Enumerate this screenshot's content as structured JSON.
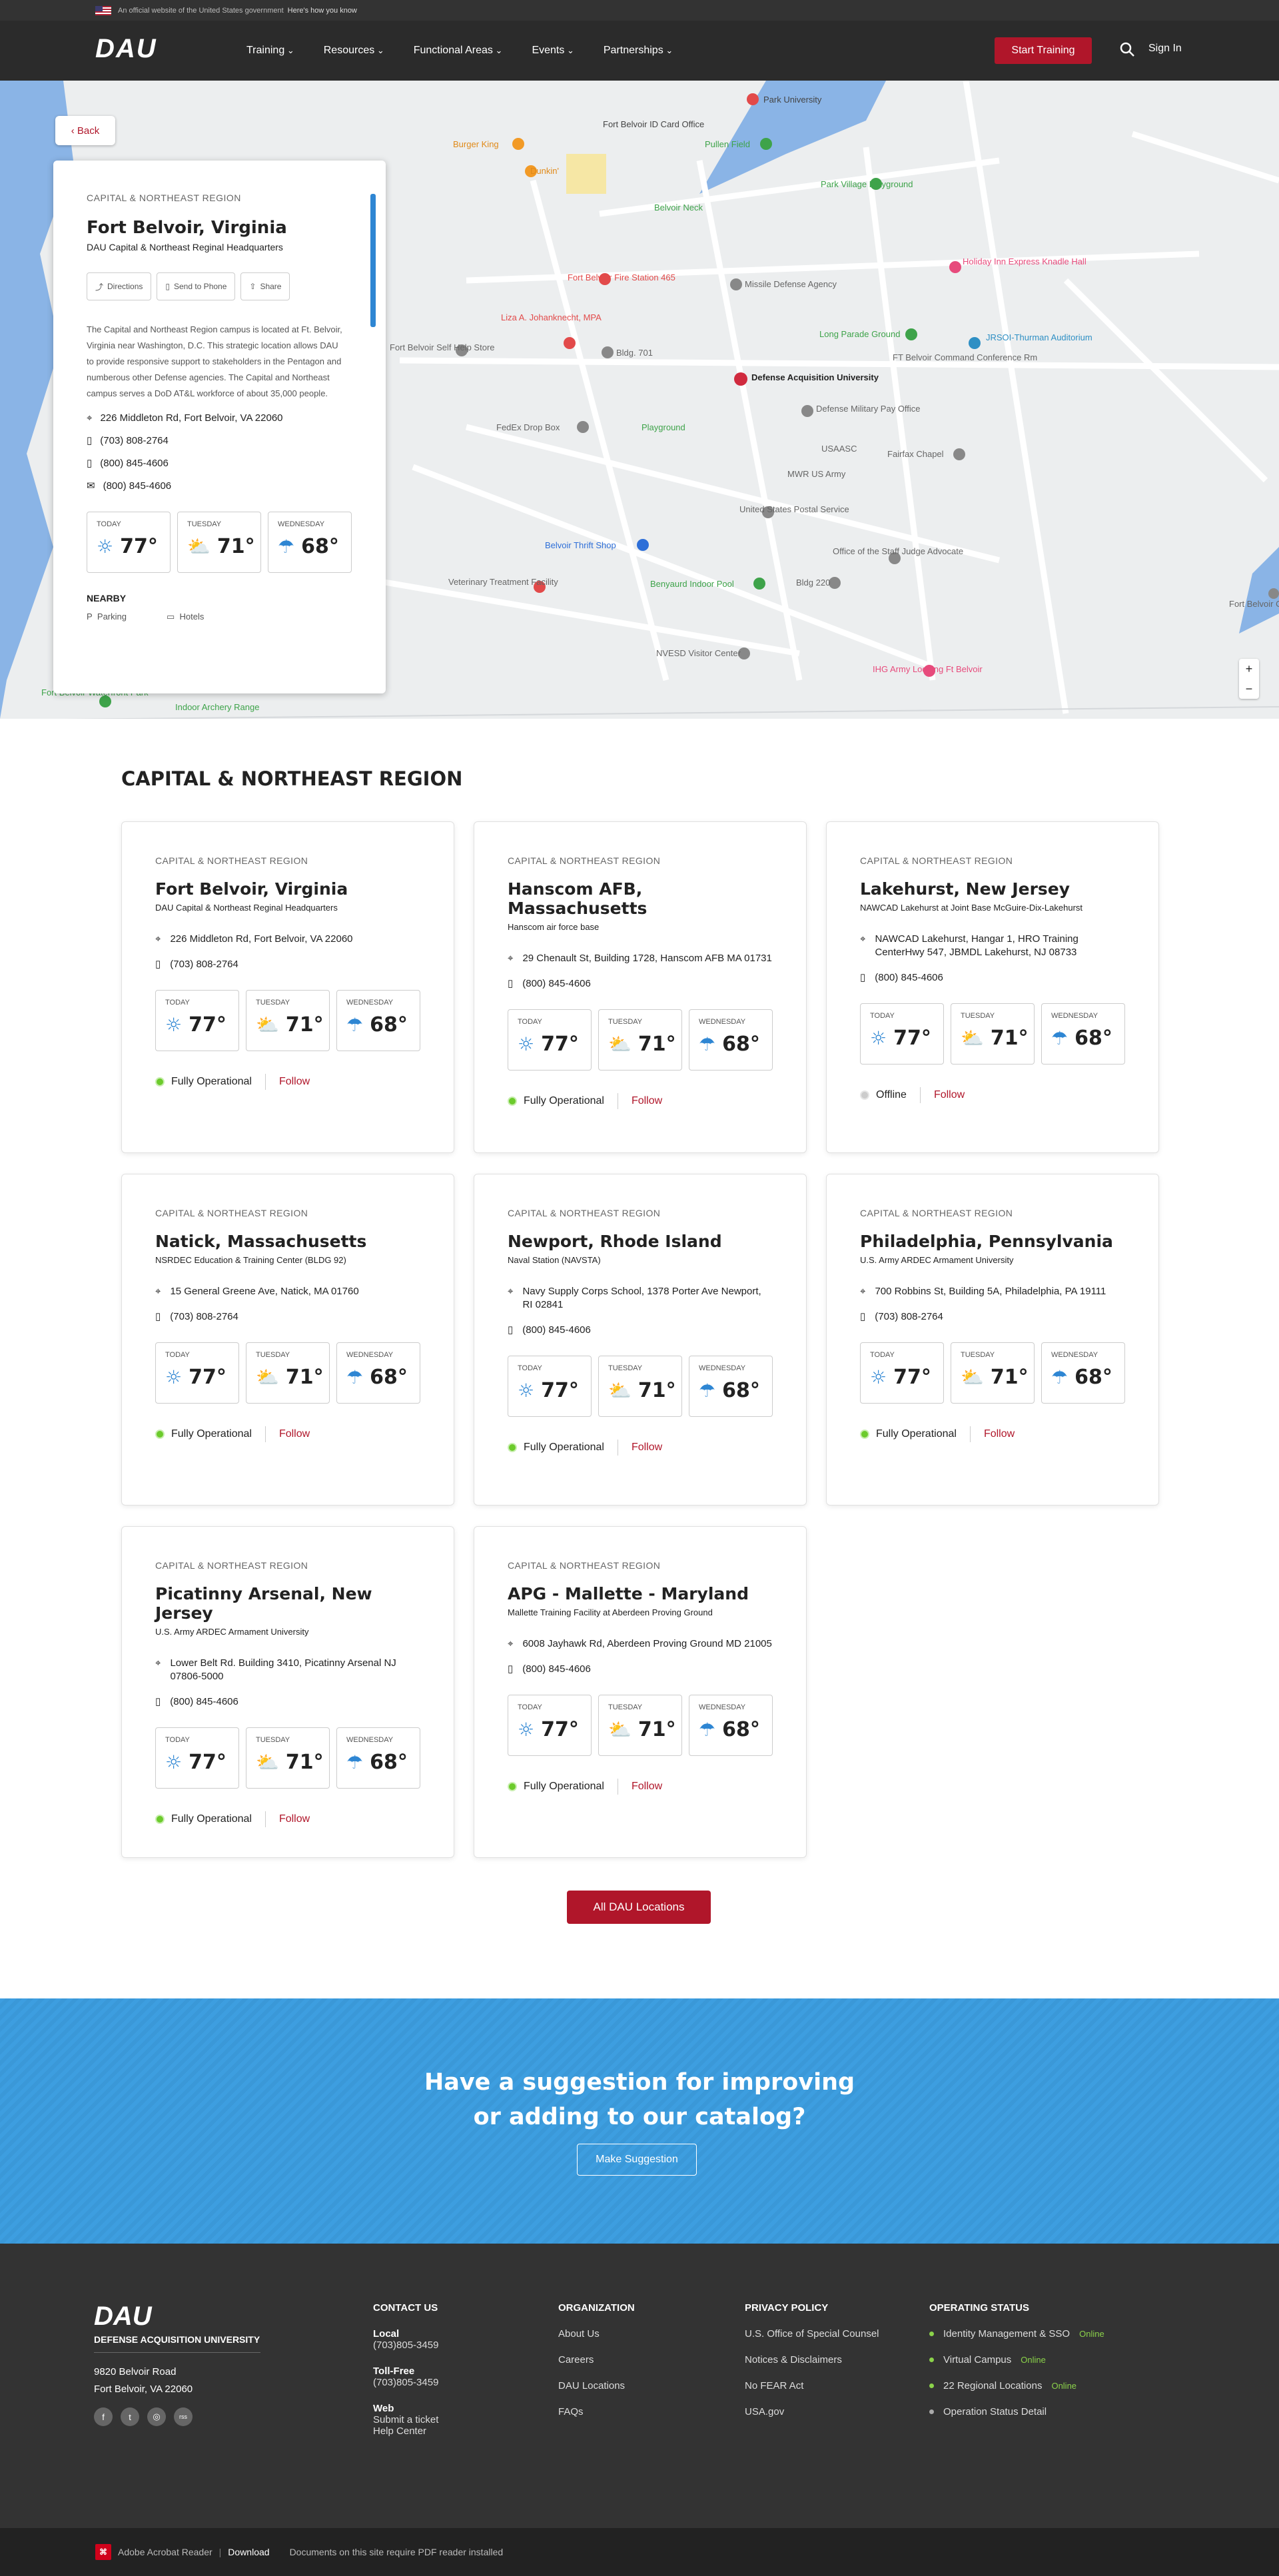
{
  "gov_banner": {
    "text": "An official website of the United States government",
    "how": "Here's how you know"
  },
  "nav": {
    "logo": "DAU",
    "menu": [
      "Training",
      "Resources",
      "Functional Areas",
      "Events",
      "Partnerships"
    ],
    "start": "Start Training",
    "signin": "Sign In"
  },
  "map": {
    "back": "Back",
    "labels": [
      "Park University",
      "Fort Belvoir ID Card Office",
      "Burger King",
      "Pullen Field",
      "Dunkin'",
      "Park Village Playground",
      "Belvoir Neck",
      "Holiday Inn Express Knadle Hall",
      "Fort Belvoir Fire Station 465",
      "Missile Defense Agency",
      "Liza A. Johanknecht, MPA",
      "Long Parade Ground",
      "JRSOI-Thurman Auditorium",
      "Fort Belvoir Self Help Store",
      "Bldg. 701",
      "FT Belvoir Command Conference Rm",
      "Defense Acquisition University",
      "Defense Military Pay Office",
      "FedEx Drop Box",
      "Playground",
      "USAASC",
      "Fairfax Chapel",
      "MWR US Army",
      "United States Postal Service",
      "Belvoir Thrift Shop",
      "Office of the Staff Judge Advocate",
      "Veterinary Treatment Facility",
      "Benyaurd Indoor Pool",
      "Bldg 220",
      "NVESD Visitor Center",
      "IHG Army Lodging Ft Belvoir",
      "Fort Belvoir Officers Club",
      "Fort Belvoir Waterfront Park",
      "Indoor Archery Range"
    ],
    "zoom_in": "+",
    "zoom_out": "−"
  },
  "panel": {
    "region": "CAPITAL & NORTHEAST REGION",
    "title": "Fort Belvoir, Virginia",
    "subtitle": "DAU Capital & Northeast Reginal Headquarters",
    "actions": [
      "Directions",
      "Send to Phone",
      "Share"
    ],
    "description": "The Capital and Northeast Region campus is located at Ft. Belvoir, Virginia near Washington, D.C. This strategic location allows DAU to provide responsive support to stakeholders in the Pentagon and numberous other Defense agencies. The Capital and Northeast campus serves a DoD AT&L workforce of about 35,000 people.",
    "address": "226 Middleton Rd, Fort Belvoir, VA 22060",
    "phones": [
      "(703) 808-2764",
      "(800) 845-4606",
      "(800) 845-4606"
    ],
    "weather": [
      {
        "day": "TODAY",
        "temp": "77°"
      },
      {
        "day": "TUESDAY",
        "temp": "71°"
      },
      {
        "day": "WEDNESDAY",
        "temp": "68°"
      }
    ],
    "nearby_title": "NEARBY",
    "nearby": [
      "Parking",
      "Hotels"
    ]
  },
  "section_title": "CAPITAL & NORTHEAST REGION",
  "cards": [
    {
      "region": "CAPITAL & NORTHEAST REGION",
      "title": "Fort Belvoir, Virginia",
      "subtitle": "DAU Capital & Northeast Reginal Headquarters",
      "address": "226 Middleton Rd, Fort Belvoir, VA 22060",
      "phone": "(703) 808-2764",
      "status": "Fully Operational",
      "follow": "Follow"
    },
    {
      "region": "CAPITAL & NORTHEAST REGION",
      "title": "Hanscom AFB, Massachusetts",
      "subtitle": "Hanscom air force base",
      "address": "29 Chenault St, Building 1728, Hanscom AFB MA 01731",
      "phone": "(800) 845-4606",
      "status": "Fully Operational",
      "follow": "Follow"
    },
    {
      "region": "CAPITAL & NORTHEAST REGION",
      "title": "Lakehurst, New Jersey",
      "subtitle": "NAWCAD Lakehurst at Joint Base McGuire-Dix-Lakehurst",
      "address": "NAWCAD Lakehurst, Hangar 1, HRO Training CenterHwy 547, JBMDL Lakehurst, NJ 08733",
      "phone": "(800) 845-4606",
      "status": "Offline",
      "follow": "Follow"
    },
    {
      "region": "CAPITAL & NORTHEAST REGION",
      "title": "Natick, Massachusetts",
      "subtitle": "NSRDEC Education & Training Center (BLDG 92)",
      "address": "15 General Greene Ave, Natick, MA 01760",
      "phone": "(703) 808-2764",
      "status": "Fully Operational",
      "follow": "Follow"
    },
    {
      "region": "CAPITAL & NORTHEAST REGION",
      "title": "Newport, Rhode Island",
      "subtitle": "Naval Station (NAVSTA)",
      "address": "Navy Supply Corps School, 1378 Porter Ave Newport, RI 02841",
      "phone": "(800) 845-4606",
      "status": "Fully Operational",
      "follow": "Follow"
    },
    {
      "region": "CAPITAL & NORTHEAST REGION",
      "title": "Philadelphia, Pennsylvania",
      "subtitle": "U.S. Army ARDEC Armament University",
      "address": "700 Robbins St, Building 5A, Philadelphia, PA 19111",
      "phone": "(703) 808-2764",
      "status": "Fully Operational",
      "follow": "Follow"
    },
    {
      "region": "CAPITAL & NORTHEAST REGION",
      "title": "Picatinny Arsenal, New Jersey",
      "subtitle": "U.S. Army ARDEC Armament University",
      "address": "Lower Belt Rd. Building 3410, Picatinny Arsenal NJ 07806-5000",
      "phone": "(800) 845-4606",
      "status": "Fully Operational",
      "follow": "Follow"
    },
    {
      "region": "CAPITAL & NORTHEAST REGION",
      "title": "APG - Mallette - Maryland",
      "subtitle": "Mallette Training Facility at Aberdeen Proving Ground",
      "address": "6008 Jayhawk Rd, Aberdeen Proving Ground MD 21005",
      "phone": "(800) 845-4606",
      "status": "Fully Operational",
      "follow": "Follow"
    }
  ],
  "weather": [
    {
      "day": "TODAY",
      "temp": "77°"
    },
    {
      "day": "TUESDAY",
      "temp": "71°"
    },
    {
      "day": "WEDNESDAY",
      "temp": "68°"
    }
  ],
  "all_locations": "All DAU Locations",
  "suggest": {
    "line1": "Have a suggestion for improving",
    "line2": "or adding to our catalog?",
    "button": "Make Suggestion"
  },
  "footer": {
    "logo": "DAU",
    "name": "DEFENSE ACQUISITION UNIVERSITY",
    "address1": "9820 Belvoir Road",
    "address2": "Fort Belvoir, VA 22060",
    "social": [
      "f",
      "t",
      "◎",
      "rss"
    ],
    "contact": {
      "heading": "CONTACT US",
      "local_label": "Local",
      "local": "(703)805-3459",
      "tollfree_label": "Toll-Free",
      "tollfree": "(703)805-3459",
      "web_label": "Web",
      "web1": "Submit a ticket",
      "web2": "Help Center"
    },
    "organization": {
      "heading": "ORGANIZATION",
      "items": [
        "About Us",
        "Careers",
        "DAU Locations",
        "FAQs"
      ]
    },
    "privacy": {
      "heading": "PRIVACY POLICY",
      "items": [
        "U.S. Office of Special Counsel",
        "Notices & Disclaimers",
        "No FEAR Act",
        "USA.gov"
      ]
    },
    "operating": {
      "heading": "OPERATING STATUS",
      "items": [
        {
          "label": "Identity Management & SSO",
          "status": "Online"
        },
        {
          "label": "Virtual Campus",
          "status": "Online"
        },
        {
          "label": "22 Regional Locations",
          "status": "Online"
        },
        {
          "label": "Operation Status Detail",
          "status": ""
        }
      ]
    }
  },
  "bottom": {
    "reader": "Adobe Acrobat Reader",
    "download": "Download",
    "note": "Documents on this site require PDF reader installed"
  }
}
